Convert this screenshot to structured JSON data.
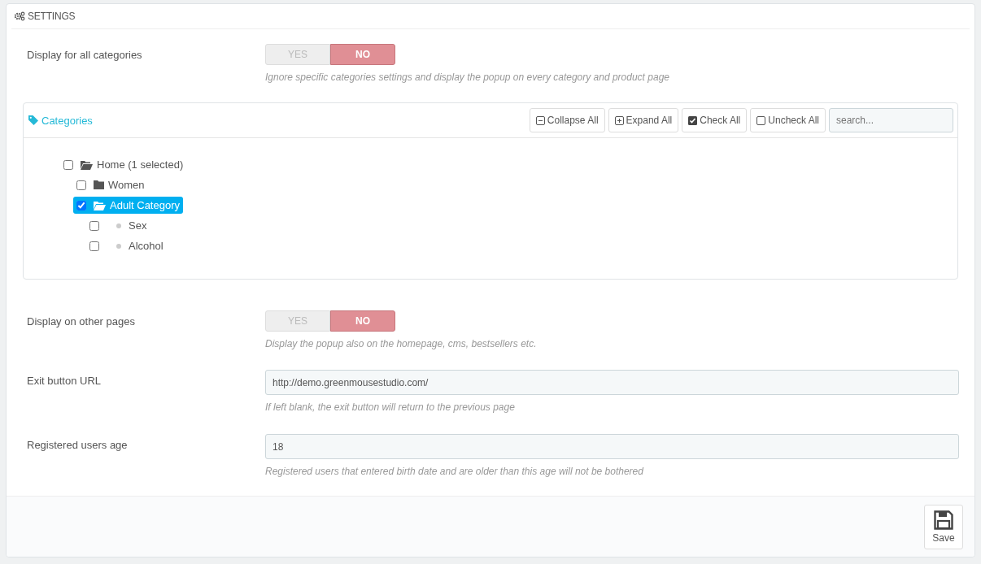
{
  "panel": {
    "title": "SETTINGS"
  },
  "display_all": {
    "label": "Display for all categories",
    "options": [
      {
        "label": "YES",
        "selected": false
      },
      {
        "label": "NO",
        "selected": true
      }
    ],
    "help": "Ignore specific categories settings and display the popup on every category and product page"
  },
  "categories": {
    "title": "Categories",
    "toolbar": [
      {
        "kind": "collapse",
        "label": "Collapse All"
      },
      {
        "kind": "expand",
        "label": "Expand All"
      },
      {
        "kind": "check",
        "label": "Check All"
      },
      {
        "kind": "uncheck",
        "label": "Uncheck All"
      }
    ],
    "search": {
      "placeholder": "search..."
    },
    "tree": [
      {
        "label": "Home (1 selected)",
        "kind": "folder",
        "expanded": true,
        "checked": false,
        "selected": false,
        "children": [
          {
            "label": "Women",
            "kind": "folder",
            "expanded": false,
            "checked": false,
            "selected": false
          },
          {
            "label": "Adult Category",
            "kind": "folder",
            "expanded": true,
            "checked": true,
            "selected": true,
            "children": [
              {
                "label": "Sex",
                "kind": "leaf",
                "checked": false,
                "selected": false
              },
              {
                "label": "Alcohol",
                "kind": "leaf",
                "checked": false,
                "selected": false
              }
            ]
          }
        ]
      }
    ]
  },
  "display_other": {
    "label": "Display on other pages",
    "options": [
      {
        "label": "YES",
        "selected": false
      },
      {
        "label": "NO",
        "selected": true
      }
    ],
    "help": "Display the popup also on the homepage, cms, bestsellers etc."
  },
  "exit_url": {
    "label": "Exit button URL",
    "value": "http://demo.greenmousestudio.com/",
    "help": "If left blank, the exit button will return to the previous page"
  },
  "age": {
    "label": "Registered users age",
    "value": "18",
    "help": "Registered users that entered birth date and are older than this age will not be bothered"
  },
  "footer": {
    "save": "Save"
  }
}
